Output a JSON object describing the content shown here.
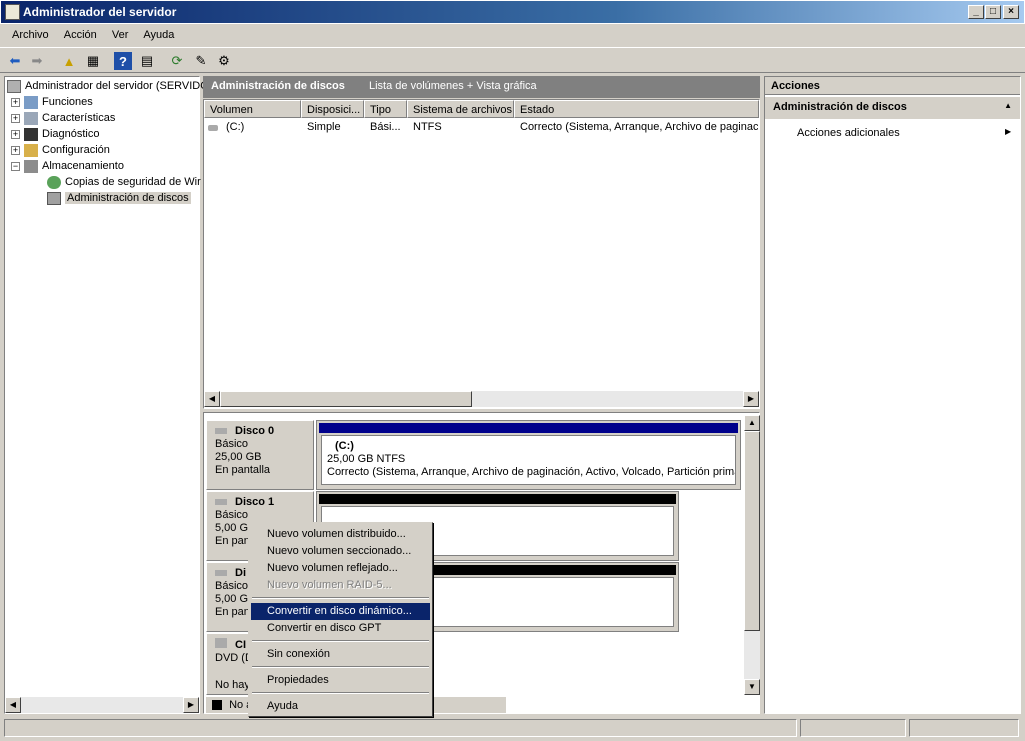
{
  "window": {
    "title": "Administrador del servidor"
  },
  "menu": [
    "Archivo",
    "Acción",
    "Ver",
    "Ayuda"
  ],
  "tree": {
    "root": "Administrador del servidor (SERVIDO",
    "items": [
      {
        "label": "Funciones"
      },
      {
        "label": "Características"
      },
      {
        "label": "Diagnóstico"
      },
      {
        "label": "Configuración"
      },
      {
        "label": "Almacenamiento"
      },
      {
        "label": "Copias de seguridad de Wir"
      },
      {
        "label": "Administración de discos"
      }
    ]
  },
  "center": {
    "title": "Administración de discos",
    "subtitle": "Lista de volúmenes + Vista gráfica",
    "columns": [
      "Volumen",
      "Disposici...",
      "Tipo",
      "Sistema de archivos",
      "Estado"
    ],
    "rows": [
      {
        "volume": "(C:)",
        "layout": "Simple",
        "type": "Bási...",
        "fs": "NTFS",
        "status": "Correcto (Sistema, Arranque, Archivo de paginación"
      }
    ]
  },
  "disks": [
    {
      "name": "Disco 0",
      "type": "Básico",
      "size": "25,00 GB",
      "state": "En pantalla",
      "volume": {
        "name": "(C:)",
        "size": "25,00 GB NTFS",
        "status": "Correcto (Sistema, Arranque, Archivo de paginación, Activo, Volcado, Partición primaria"
      }
    },
    {
      "name": "Disco 1",
      "type": "Básico",
      "size": "5,00 GI",
      "state": "En pan"
    },
    {
      "name": "Di",
      "type": "Básico",
      "size": "5,00 GI",
      "state": "En pan"
    },
    {
      "name": "CI",
      "type": "DVD (D",
      "size": "",
      "state": "No hay"
    }
  ],
  "legend": {
    "unassigned": "No a"
  },
  "context_menu": {
    "items": [
      {
        "label": "Nuevo volumen distribuido...",
        "disabled": false
      },
      {
        "label": "Nuevo volumen seccionado...",
        "disabled": false
      },
      {
        "label": "Nuevo volumen reflejado...",
        "disabled": false
      },
      {
        "label": "Nuevo volumen RAID-5...",
        "disabled": true
      },
      {
        "label": "Convertir en disco dinámico...",
        "selected": true
      },
      {
        "label": "Convertir en disco GPT"
      },
      {
        "label": "Sin conexión"
      },
      {
        "label": "Propiedades"
      },
      {
        "label": "Ayuda"
      }
    ]
  },
  "actions": {
    "header": "Acciones",
    "section": "Administración de discos",
    "item": "Acciones adicionales"
  },
  "colors": {
    "selection": "#0a246a",
    "primary_partition": "#00008b",
    "unallocated": "#000000"
  }
}
